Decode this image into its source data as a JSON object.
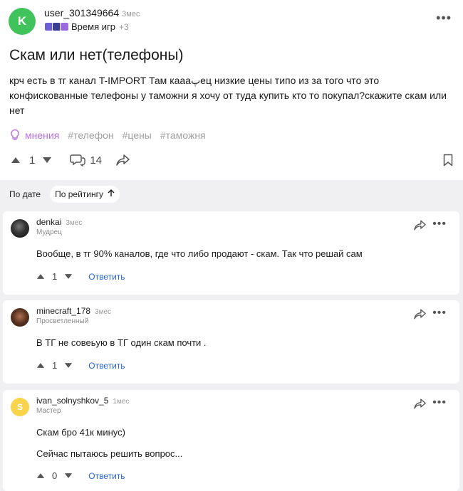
{
  "post": {
    "avatar_letter": "K",
    "username": "user_301349664",
    "time": "3мес",
    "badge_label": "Время игр",
    "badge_more": "+3",
    "title": "Скам или нет(телефоны)",
    "text": "крч есть в тг канал T-IMPORT Там каааپец низкие цены типо из за того что это конфискованные телефоны у таможни я хочу от туда купить кто то покупал?скажите скам или нет",
    "tags": [
      "мнения",
      "#телефон",
      "#цены",
      "#таможня"
    ],
    "votes": "1",
    "comments_count": "14"
  },
  "sort": {
    "by_date": "По дате",
    "by_rating": "По рейтингу"
  },
  "comments": [
    {
      "username": "denkai",
      "time": "3мес",
      "rank": "Мудрец",
      "text": "Вообще, в тг 90% каналов, где что либо продают - скам. Так что решай сам",
      "votes": "1",
      "reply": "Ответить"
    },
    {
      "username": "minecraft_178",
      "time": "3мес",
      "rank": "Просветленный",
      "text": "В ТГ не совеьую в ТГ один скам почти .",
      "votes": "1",
      "reply": "Ответить"
    },
    {
      "username": "ivan_solnyshkov_5",
      "time": "1мес",
      "rank": "Мастер",
      "avatar_letter": "S",
      "text": "Скам бро 41к минус)",
      "text2": "Сейчас пытаюсь решить вопрос...",
      "votes": "0",
      "reply": "Ответить"
    }
  ],
  "colors": {
    "accent": "#2566d6",
    "avatar_green": "#3fc35a",
    "tag_purple": "#b970e0",
    "avatar_yellow": "#f7d44a"
  }
}
